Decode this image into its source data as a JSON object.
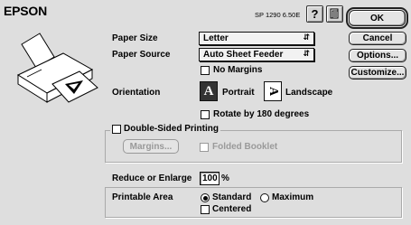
{
  "brand": "EPSON",
  "model_version": "SP 1290 6.50E",
  "help_icon_glyph": "?",
  "buttons": {
    "ok": "OK",
    "cancel": "Cancel",
    "options": "Options...",
    "customize": "Customize..."
  },
  "paper_size": {
    "label": "Paper Size",
    "value": "Letter"
  },
  "paper_source": {
    "label": "Paper Source",
    "value": "Auto Sheet Feeder"
  },
  "no_margins": {
    "label": "No Margins",
    "checked": false
  },
  "orientation": {
    "label": "Orientation",
    "portrait": "Portrait",
    "portrait_glyph": "A",
    "landscape": "Landscape",
    "landscape_glyph": "A",
    "selected": "portrait"
  },
  "rotate_180": {
    "label": "Rotate by 180 degrees",
    "checked": false
  },
  "double_sided": {
    "label": "Double-Sided Printing",
    "checked": false,
    "margins_button": "Margins...",
    "folded_booklet": "Folded Booklet"
  },
  "reduce_enlarge": {
    "label": "Reduce or Enlarge",
    "value": "100",
    "unit": "%"
  },
  "printable_area": {
    "label": "Printable Area",
    "standard": "Standard",
    "maximum": "Maximum",
    "centered": "Centered",
    "selected": "standard",
    "centered_checked": false
  },
  "colors": {
    "background": "#dedede",
    "accent": "#000000"
  }
}
